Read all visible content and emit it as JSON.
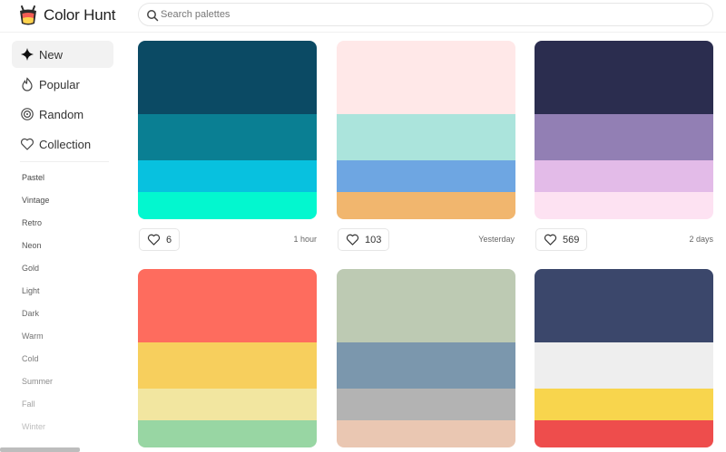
{
  "header": {
    "brand": "Color Hunt",
    "search_placeholder": "Search palettes"
  },
  "sidebar": {
    "nav": [
      {
        "label": "New",
        "icon": "sparkle-icon",
        "active": true
      },
      {
        "label": "Popular",
        "icon": "flame-icon",
        "active": false
      },
      {
        "label": "Random",
        "icon": "spiral-icon",
        "active": false
      },
      {
        "label": "Collection",
        "icon": "heart-icon",
        "active": false
      }
    ],
    "tags": [
      "Pastel",
      "Vintage",
      "Retro",
      "Neon",
      "Gold",
      "Light",
      "Dark",
      "Warm",
      "Cold",
      "Summer",
      "Fall",
      "Winter"
    ]
  },
  "palettes": [
    {
      "colors": [
        "#0b4a64",
        "#0a7f93",
        "#08c1df",
        "#03f7cf"
      ],
      "likes": "6",
      "time": "1 hour"
    },
    {
      "colors": [
        "#ffe8e8",
        "#abe4dc",
        "#6ea6e2",
        "#f1b66e"
      ],
      "likes": "103",
      "time": "Yesterday"
    },
    {
      "colors": [
        "#2b2d4f",
        "#927fb4",
        "#e3bbe8",
        "#fde2f2"
      ],
      "likes": "569",
      "time": "2 days"
    },
    {
      "colors": [
        "#fe6c5e",
        "#f7cf5d",
        "#f2e6a0",
        "#98d6a3"
      ],
      "likes": "",
      "time": ""
    },
    {
      "colors": [
        "#bdcab3",
        "#7b97ad",
        "#b3b3b3",
        "#eac7b2"
      ],
      "likes": "",
      "time": ""
    },
    {
      "colors": [
        "#3b476b",
        "#eeeeee",
        "#f8d54d",
        "#ee4d4c"
      ],
      "likes": "",
      "time": ""
    }
  ]
}
